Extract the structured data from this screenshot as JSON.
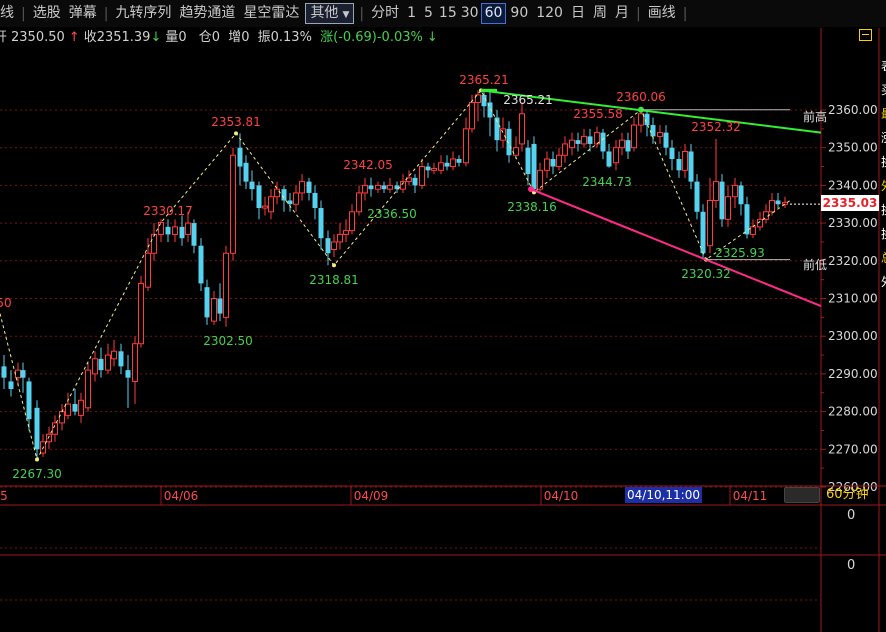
{
  "toolbar": {
    "items": [
      "选股",
      "弹幕",
      "九转序列",
      "趋势通道",
      "星空雷达"
    ],
    "dropdown": "其他",
    "periods": [
      "分时",
      "1",
      "5",
      "15",
      "30",
      "60",
      "90",
      "120",
      "日",
      "周",
      "月"
    ],
    "active_period": "60",
    "draw": "画线",
    "cut_left": "线"
  },
  "stats": {
    "open_prefix": "开",
    "open": "2350.50",
    "close_label": "收2351.39",
    "volume": "量0",
    "position": "仓0",
    "increase": "增0",
    "amplitude": "振0.13%",
    "change": "涨(-0.69)-0.03%"
  },
  "y_ticks": [
    "2360.00",
    "2350.00",
    "2340.00",
    "2330.00",
    "2320.00",
    "2310.00",
    "2300.00",
    "2290.00",
    "2280.00",
    "2270.00",
    "2260.00"
  ],
  "x_labels": [
    "5",
    "04/06",
    "04/09",
    "04/10",
    "04/11"
  ],
  "x_active_label": "04/10,11:00",
  "period_label": "60分钟",
  "current_price": "2335.03",
  "sub_values": [
    "0",
    "0"
  ],
  "right_cut_text": [
    "前高",
    "前低"
  ],
  "pivot_labels": {
    "red": [
      "2365.21",
      "2353.81",
      "2342.05",
      "2330.17",
      "2355.58",
      "2360.06",
      "2352.32",
      "50"
    ],
    "green": [
      "2267.30",
      "2302.50",
      "2318.81",
      "2336.50",
      "2338.16",
      "2344.73",
      "2320.32",
      "2325.93"
    ],
    "white": [
      "2365.21"
    ]
  },
  "right_edge_chars": [
    "表",
    "买",
    "最",
    "涨",
    "换",
    "外",
    "换",
    "换",
    "总",
    "外"
  ],
  "colors": {
    "up": "#ff3b3b",
    "down": "#54d2f0",
    "grid": "#7a1010",
    "axis": "#a01818",
    "trend_green": "#33ee33",
    "trend_pink": "#ff2a88",
    "zigzag": "#f0f080"
  }
}
